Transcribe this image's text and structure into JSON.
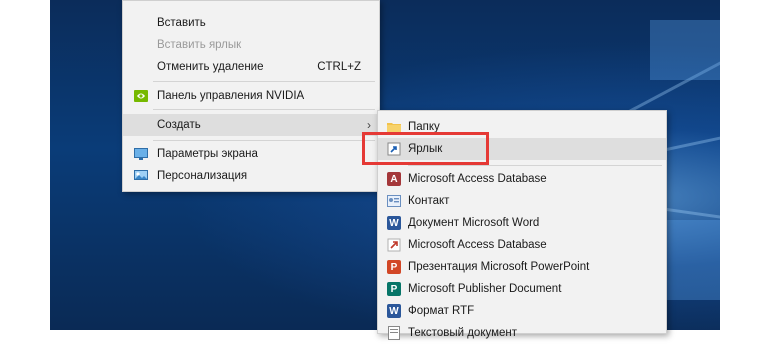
{
  "desktop_menu": {
    "items": [
      {
        "label": "Вставить",
        "shortcut": "",
        "disabled": false
      },
      {
        "label": "Вставить ярлык",
        "shortcut": "",
        "disabled": true
      },
      {
        "label": "Отменить удаление",
        "shortcut": "CTRL+Z",
        "disabled": false
      },
      {
        "label": "Панель управления NVIDIA",
        "shortcut": "",
        "icon": "nvidia-icon"
      },
      {
        "label": "Создать",
        "shortcut": "",
        "icon": "",
        "has_submenu": true
      },
      {
        "label": "Параметры экрана",
        "shortcut": "",
        "icon": "display-settings-icon"
      },
      {
        "label": "Персонализация",
        "shortcut": "",
        "icon": "personalization-icon"
      }
    ]
  },
  "new_submenu": {
    "items": [
      {
        "label": "Папку",
        "icon": "folder-icon"
      },
      {
        "label": "Ярлык",
        "icon": "shortcut-icon"
      },
      {
        "label": "Microsoft Access Database",
        "icon": "access-icon"
      },
      {
        "label": "Контакт",
        "icon": "contact-icon"
      },
      {
        "label": "Документ Microsoft Word",
        "icon": "word-icon"
      },
      {
        "label": "Microsoft Access Database",
        "icon": "access-alt-icon"
      },
      {
        "label": "Презентация Microsoft PowerPoint",
        "icon": "powerpoint-icon"
      },
      {
        "label": "Microsoft Publisher Document",
        "icon": "publisher-icon"
      },
      {
        "label": "Формат RTF",
        "icon": "rtf-icon"
      },
      {
        "label": "Текстовый документ",
        "icon": "text-document-icon"
      }
    ]
  },
  "colors": {
    "highlight_box": "#e53935",
    "menu_bg": "#f2f2f2",
    "desktop_blue": "#0a3c78"
  }
}
